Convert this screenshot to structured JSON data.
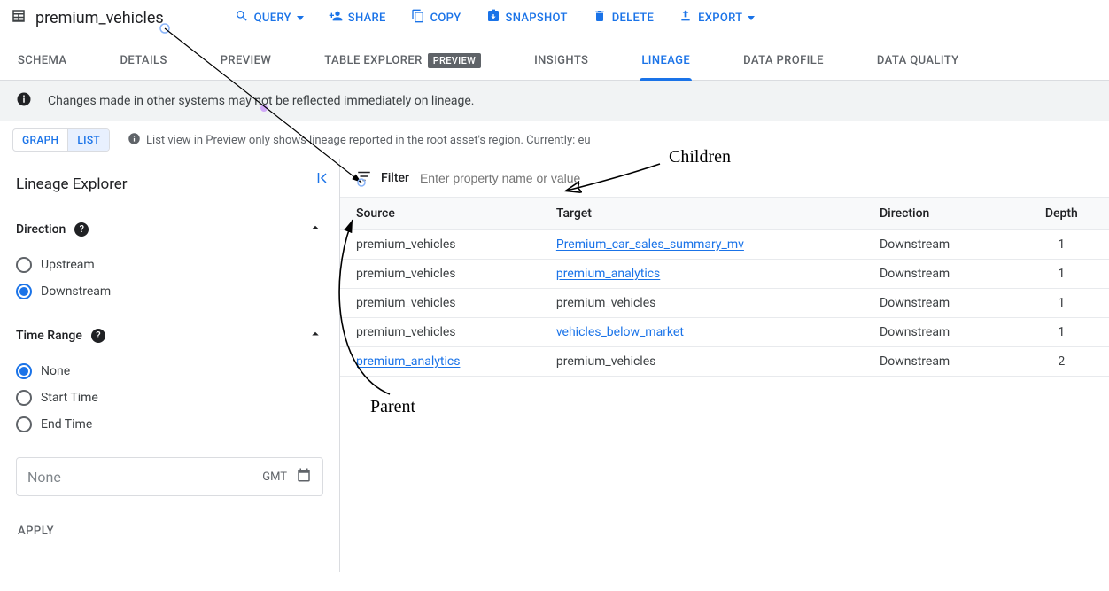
{
  "header": {
    "title": "premium_vehicles",
    "actions": {
      "query": "QUERY",
      "share": "SHARE",
      "copy": "COPY",
      "snapshot": "SNAPSHOT",
      "delete": "DELETE",
      "export": "EXPORT"
    }
  },
  "tabs": {
    "schema": "SCHEMA",
    "details": "DETAILS",
    "preview": "PREVIEW",
    "table_explorer": "TABLE EXPLORER",
    "table_explorer_badge": "PREVIEW",
    "insights": "INSIGHTS",
    "lineage": "LINEAGE",
    "data_profile": "DATA PROFILE",
    "data_quality": "DATA QUALITY"
  },
  "info_bar": "Changes made in other systems may not be reflected immediately on lineage.",
  "view_bar": {
    "graph": "GRAPH",
    "list": "LIST",
    "hint": "List view in Preview only shows lineage reported in the root asset's region. Currently: eu"
  },
  "side": {
    "title": "Lineage Explorer",
    "direction_label": "Direction",
    "direction_upstream": "Upstream",
    "direction_downstream": "Downstream",
    "time_range_label": "Time Range",
    "tr_none": "None",
    "tr_start": "Start Time",
    "tr_end": "End Time",
    "date_placeholder": "None",
    "gmt": "GMT",
    "apply": "APPLY"
  },
  "filter": {
    "label": "Filter",
    "placeholder": "Enter property name or value"
  },
  "table": {
    "headers": {
      "source": "Source",
      "target": "Target",
      "direction": "Direction",
      "depth": "Depth"
    },
    "rows": [
      {
        "source": "premium_vehicles",
        "source_link": false,
        "target": "Premium_car_sales_summary_mv",
        "target_link": true,
        "direction": "Downstream",
        "depth": "1"
      },
      {
        "source": "premium_vehicles",
        "source_link": false,
        "target": "premium_analytics",
        "target_link": true,
        "direction": "Downstream",
        "depth": "1"
      },
      {
        "source": "premium_vehicles",
        "source_link": false,
        "target": "premium_vehicles",
        "target_link": false,
        "direction": "Downstream",
        "depth": "1"
      },
      {
        "source": "premium_vehicles",
        "source_link": false,
        "target": "vehicles_below_market",
        "target_link": true,
        "direction": "Downstream",
        "depth": "1"
      },
      {
        "source": "premium_analytics",
        "source_link": true,
        "target": "premium_vehicles",
        "target_link": false,
        "direction": "Downstream",
        "depth": "2"
      }
    ]
  },
  "annotations": {
    "children": "Children",
    "parent": "Parent"
  }
}
